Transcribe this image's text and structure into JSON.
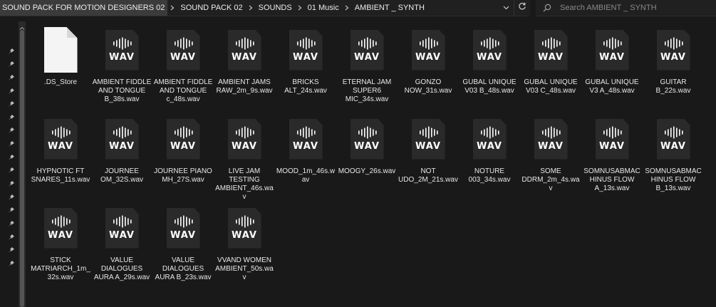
{
  "breadcrumb": [
    "SOUND PACK FOR MOTION DESIGNERS 02",
    "SOUND PACK 02",
    "SOUNDS",
    "01 Music",
    "AMBIENT _ SYNTH"
  ],
  "search": {
    "placeholder": "Search AMBIENT _ SYNTH"
  },
  "icons": {
    "chevron": "chevron-right-icon",
    "dropdown": "chevron-down-icon",
    "refresh": "refresh-icon",
    "search": "search-icon",
    "pin": "pin-icon",
    "wav": "wav-file-icon",
    "generic": "blank-file-icon"
  },
  "wav_badge": "WAV",
  "colors": {
    "background": "#191919",
    "tile": "#2a2a2a",
    "text": "#e8e8e8"
  },
  "files": [
    {
      "name": ".DS_Store",
      "type": "generic"
    },
    {
      "name": "AMBIENT FIDDLE AND TONGUE B_38s.wav",
      "type": "wav"
    },
    {
      "name": "AMBIENT FIDDLE AND TONGUE c_48s.wav",
      "type": "wav"
    },
    {
      "name": "AMBIENT JAMS RAW_2m_9s.wav",
      "type": "wav"
    },
    {
      "name": "BRICKS ALT_24s.wav",
      "type": "wav"
    },
    {
      "name": "ETERNAL JAM SUPER6 MIC_34s.wav",
      "type": "wav"
    },
    {
      "name": "GONZO NOW_31s.wav",
      "type": "wav"
    },
    {
      "name": "GUBAL UNIQUE V03 B_48s.wav",
      "type": "wav"
    },
    {
      "name": "GUBAL UNIQUE V03 C_48s.wav",
      "type": "wav"
    },
    {
      "name": "GUBAL UNIQUE V3 A_48s.wav",
      "type": "wav"
    },
    {
      "name": "GUITAR B_22s.wav",
      "type": "wav"
    },
    {
      "name": "HYPNOTIC FT SNARES_11s.wav",
      "type": "wav"
    },
    {
      "name": "JOURNEE OM_32S.wav",
      "type": "wav"
    },
    {
      "name": "JOURNEE PIANO MH_27S.wav",
      "type": "wav"
    },
    {
      "name": "LIVE JAM TESTING AMBIENT_46s.wav",
      "type": "wav"
    },
    {
      "name": "MOOD_1m_46s.wav",
      "type": "wav"
    },
    {
      "name": "MOOGY_26s.wav",
      "type": "wav"
    },
    {
      "name": "NOT UDO_2M_21s.wav",
      "type": "wav"
    },
    {
      "name": "NOTURE 003_34s.wav",
      "type": "wav"
    },
    {
      "name": "SOME DDRM_2m_4s.wav",
      "type": "wav"
    },
    {
      "name": "SOMNUSABMACHINUS FLOW A_13s.wav",
      "type": "wav"
    },
    {
      "name": "SOMNUSABMACHINUS FLOW B_13s.wav",
      "type": "wav"
    },
    {
      "name": "STICK MATRIARCH_1m_32s.wav",
      "type": "wav"
    },
    {
      "name": "VALUE DIALOGUES AURA A_29s.wav",
      "type": "wav"
    },
    {
      "name": "VALUE DIALOGUES AURA B_23s.wav",
      "type": "wav"
    },
    {
      "name": "VVAND WOMEN AMBIENT_50s.wav",
      "type": "wav"
    }
  ]
}
